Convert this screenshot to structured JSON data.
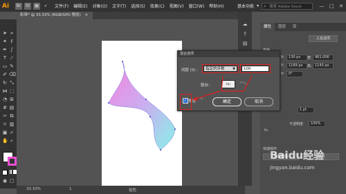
{
  "app": {
    "logo": "Ai",
    "bridge_label": "Br",
    "stock_label": "St"
  },
  "menu": [
    "文件(F)",
    "编辑(E)",
    "对象(O)",
    "文字(T)",
    "选择(S)",
    "效果(C)",
    "视图(V)",
    "窗口(W)",
    "帮助(H)"
  ],
  "topright": {
    "workspace": "基本功能",
    "search_placeholder": "搜索 Adobe Stock",
    "win_min": "—",
    "win_max": "□",
    "win_close": "✕"
  },
  "document": {
    "tab_title": "彩带* @ 33.33% (RGB/GPU 预览)",
    "tab_close": "×"
  },
  "status": {
    "zoom": "33.33%",
    "page": "1",
    "mode": "拾色"
  },
  "dialog": {
    "title": "混合选项",
    "spacing_label": "间距 (S) :",
    "spacing_option": "指定的步数",
    "spacing_value": "100",
    "orientation_label": "取向 :",
    "orient1": "ıııᵧ",
    "orient2": "⁺⁺⁺ᵧ",
    "preview_label": "预览",
    "ok_label": "确定",
    "cancel_label": "取消"
  },
  "panel": {
    "tabs": [
      "属性",
      "图层",
      "库"
    ],
    "mode_btn": "工具选项",
    "transform_label": "变换",
    "x_label": "X:",
    "x_value": "130 px",
    "w_label": "宽:",
    "w_value": "961.006",
    "y_label": "Y:",
    "y_value": "1169 px",
    "h_label": "高:",
    "h_value": "1143 px",
    "angle_value": "0°",
    "stroke_value": "1 pt",
    "opacity_label": "不透明度",
    "opacity_value": "100%",
    "fx_label": "fx.",
    "quick_label": "快速操作",
    "recolor_btn": "重新着色",
    "arrange_btn": "排列"
  },
  "watermark": {
    "brand": "Baidu经验",
    "url": "jingyan.baidu.com"
  },
  "colors": {
    "accent_red": "#e02020",
    "gradient_pink": "#f57ad8",
    "gradient_cyan": "#7ff0e6"
  }
}
